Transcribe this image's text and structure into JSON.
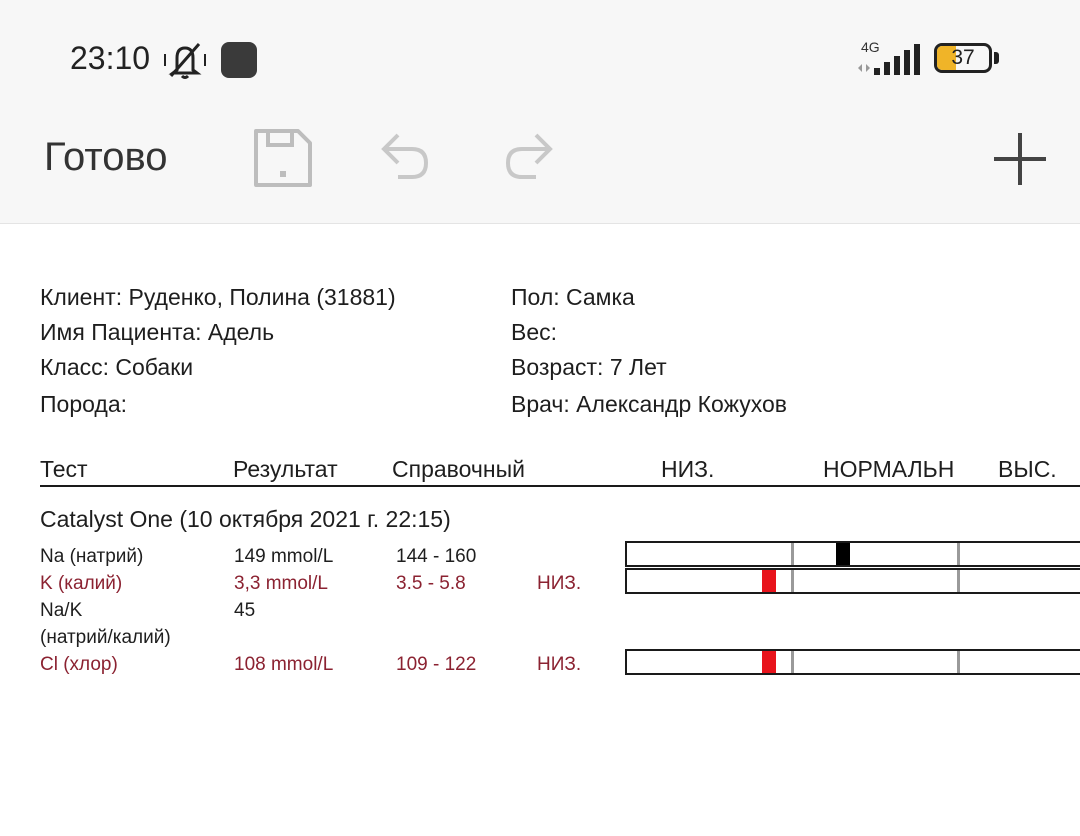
{
  "status": {
    "time": "23:10",
    "network": "4G",
    "battery_level": "37",
    "battery_fraction": 0.37,
    "icons": [
      "muted-bell-icon",
      "app-notification-icon",
      "signal-icon",
      "battery-icon"
    ]
  },
  "toolbar": {
    "done_label": "Готово",
    "icons": [
      "save-icon",
      "undo-icon",
      "redo-icon",
      "plus-icon"
    ]
  },
  "patient": {
    "client": "Клиент: Руденко, Полина (31881)",
    "name": "Имя Пациента: Адель",
    "class": "Класс: Собаки",
    "breed": "Порода:",
    "sex": "Пол: Самка",
    "weight": "Вес:",
    "age": "Возраст: 7 Лет",
    "doctor": "Врач: Александр Кожухов"
  },
  "table": {
    "headers": {
      "test": "Тест",
      "result": "Результат",
      "reference": "Справочный",
      "low": "НИЗ.",
      "normal": "НОРМАЛЬН",
      "high": "ВЫС."
    },
    "group_title": "Catalyst One (10 октября 2021 г. 22:15)",
    "rows": [
      {
        "test": "Na (натрий)",
        "result": "149 mmol/L",
        "reference": "144 - 160",
        "flag": "",
        "status": "normal",
        "value": 149,
        "ref_low": 144,
        "ref_high": 160
      },
      {
        "test": "K (калий)",
        "result": "3,3 mmol/L",
        "reference": "3.5 - 5.8",
        "flag": "НИЗ.",
        "status": "low",
        "value": 3.3,
        "ref_low": 3.5,
        "ref_high": 5.8
      },
      {
        "test_line1": "Na/K",
        "test_line2": "(натрий/калий)",
        "result": "45",
        "reference": "",
        "flag": "",
        "status": "none"
      },
      {
        "test": "Cl (хлор)",
        "result": "108 mmol/L",
        "reference": "109 - 122",
        "flag": "НИЗ.",
        "status": "low",
        "value": 108,
        "ref_low": 109,
        "ref_high": 122
      }
    ]
  },
  "colors": {
    "abnormal_text": "#8b2231",
    "low_marker": "#e8141c",
    "normal_marker": "#000000",
    "battery": "#f0b428"
  }
}
